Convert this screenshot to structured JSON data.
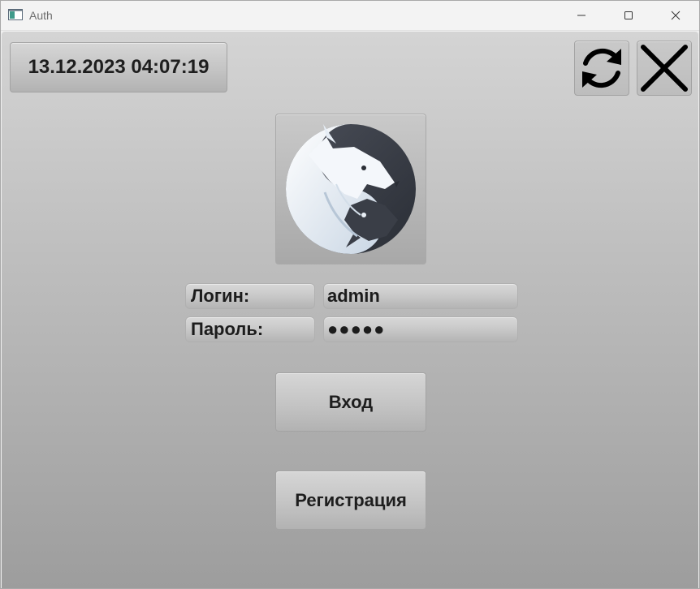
{
  "window": {
    "title": "Auth"
  },
  "header": {
    "datetime": "13.12.2023 04:07:19",
    "refresh_icon": "refresh-icon",
    "close_icon": "close-icon"
  },
  "logo": {
    "icon": "wolf-yin-yang-logo"
  },
  "form": {
    "login_label": "Логин:",
    "login_value": "admin",
    "password_label": "Пароль:",
    "password_value": "●●●●●"
  },
  "actions": {
    "enter_label": "Вход",
    "register_label": "Регистрация"
  }
}
